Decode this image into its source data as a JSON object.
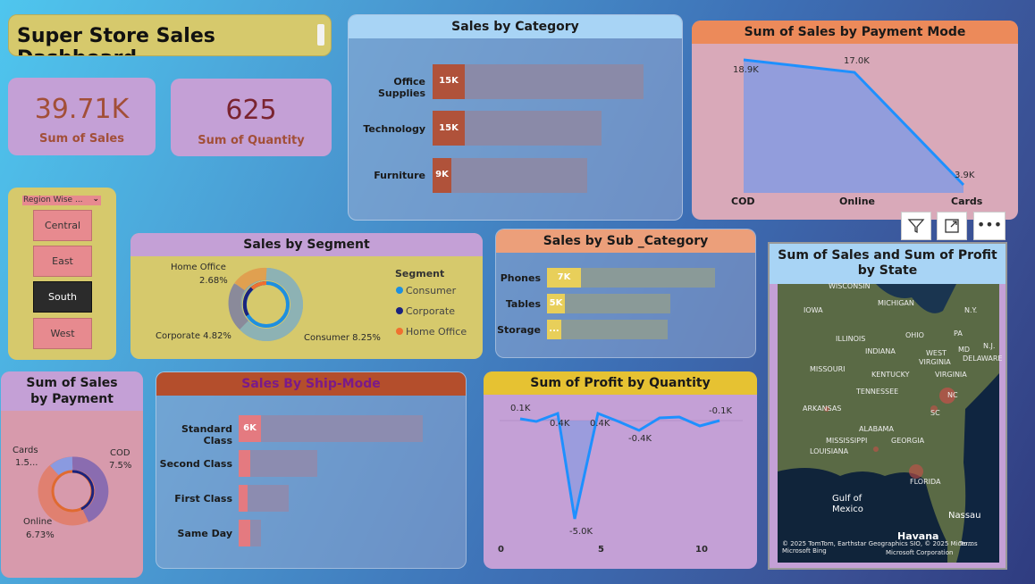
{
  "title": "Super Store Sales Dashboard",
  "kpi": {
    "sales_value": "39.71K",
    "sales_label": "Sum of Sales",
    "qty_value": "625",
    "qty_label": "Sum of Quantity"
  },
  "slicer": {
    "label": "Region Wise ...",
    "items": [
      "Central",
      "East",
      "South",
      "West"
    ],
    "selected": "South"
  },
  "category": {
    "title": "Sales by Category",
    "labels": [
      "Office Supplies",
      "Technology",
      "Furniture"
    ],
    "values": [
      "15K",
      "15K",
      "9K"
    ]
  },
  "payment_mode": {
    "title": "Sum of Sales by Payment Mode",
    "categories": [
      "COD",
      "Online",
      "Cards"
    ],
    "value_labels": [
      "18.9K",
      "17.0K",
      "3.9K"
    ]
  },
  "segment": {
    "title": "Sales by Segment",
    "legend_title": "Segment",
    "legend": [
      "Consumer",
      "Corporate",
      "Home Office"
    ],
    "labels": [
      "Home Office",
      "2.68%",
      "Corporate 4.82%",
      "Consumer 8.25%"
    ]
  },
  "subcat": {
    "title": "Sales by Sub _Category",
    "labels": [
      "Phones",
      "Tables",
      "Storage"
    ],
    "values": [
      "7K",
      "5K",
      "..."
    ]
  },
  "map": {
    "title": "Sum of Sales and Sum of Profit by State",
    "places": [
      "WISCONSIN",
      "MICHIGAN",
      "IOWA",
      "N.Y.",
      "OHIO",
      "PA",
      "ILLINOIS",
      "INDIANA",
      "WEST",
      "VIRGINIA",
      "N.J.",
      "MD",
      "DELAWARE",
      "MISSOURI",
      "KENTUCKY",
      "VIRGINIA",
      "TENNESSEE",
      "NC",
      "ARKANSAS",
      "SC",
      "ALABAMA",
      "MISSISSIPPI",
      "GEORGIA",
      "LOUISIANA",
      "FLORIDA",
      "Gulf of",
      "Mexico",
      "Nassau",
      "Havana"
    ],
    "attribution": "© 2025 TomTom, Earthstar Geographics SIO, © 2025 Micro...",
    "bing": "Microsoft Bing",
    "corp": "Microsoft Corporation",
    "terms": "Terms"
  },
  "payment": {
    "title": "Sum of Sales by Payment",
    "labels": [
      "Cards",
      "1.5...",
      "COD",
      "7.5%",
      "Online",
      "6.73%"
    ]
  },
  "shipmode": {
    "title": "Sales By Ship-Mode",
    "labels": [
      "Standard Class",
      "Second Class",
      "First Class",
      "Same Day"
    ],
    "values": [
      "6K",
      "",
      "",
      ""
    ]
  },
  "profit": {
    "title": "Sum of Profit by Quantity",
    "labels": [
      "0.1K",
      "0.4K",
      "0.4K",
      "-0.4K",
      "-0.1K",
      "-5.0K"
    ],
    "ticks": [
      "0",
      "5",
      "10"
    ]
  },
  "chart_data": [
    {
      "type": "bar",
      "title": "Sales by Category",
      "categories": [
        "Office Supplies",
        "Technology",
        "Furniture"
      ],
      "values": [
        15000,
        14500,
        9000
      ]
    },
    {
      "type": "area",
      "title": "Sum of Sales by Payment Mode",
      "categories": [
        "COD",
        "Online",
        "Cards"
      ],
      "values": [
        18900,
        17000,
        3900
      ]
    },
    {
      "type": "pie",
      "title": "Sales by Segment",
      "categories": [
        "Consumer",
        "Corporate",
        "Home Office"
      ],
      "values": [
        8.25,
        4.82,
        2.68
      ]
    },
    {
      "type": "bar",
      "title": "Sales by Sub _Category",
      "categories": [
        "Phones",
        "Tables",
        "Storage"
      ],
      "values": [
        7000,
        5000,
        5000
      ]
    },
    {
      "type": "pie",
      "title": "Sum of Sales by Payment",
      "categories": [
        "COD",
        "Online",
        "Cards"
      ],
      "values": [
        7.5,
        6.73,
        1.5
      ]
    },
    {
      "type": "bar",
      "title": "Sales By Ship-Mode",
      "categories": [
        "Standard Class",
        "Second Class",
        "First Class",
        "Same Day"
      ],
      "values": [
        6000,
        2600,
        1700,
        700
      ]
    },
    {
      "type": "line",
      "title": "Sum of Profit by Quantity",
      "x": [
        1,
        2,
        3,
        4,
        5,
        6,
        7,
        8,
        9,
        10,
        11
      ],
      "values": [
        0.1,
        0.0,
        0.1,
        -5.0,
        0.1,
        -0.1,
        -0.4,
        0.0,
        0.0,
        -0.1,
        0.0
      ],
      "xlim": [
        0,
        11
      ]
    }
  ]
}
